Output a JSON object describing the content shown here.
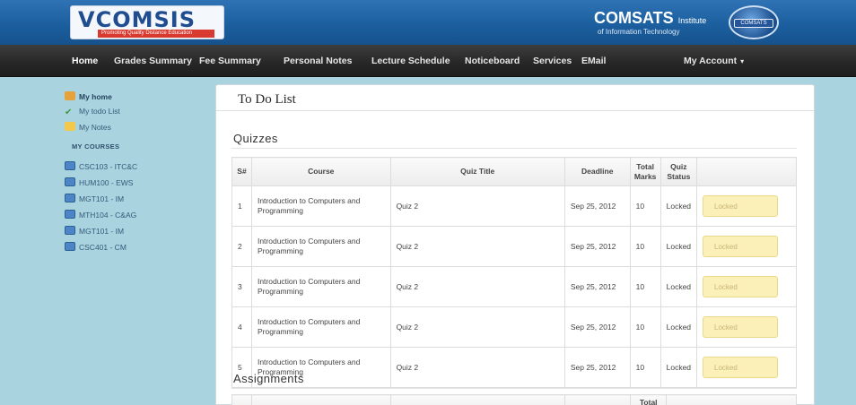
{
  "header": {
    "logo_left": {
      "wordmark": "VCOMSIS",
      "tagline": "Promoting Quality Distance Education"
    },
    "logo_right": {
      "name": "COMSATS",
      "name_suffix": "Institute",
      "subtitle": "of Information Technology",
      "seal_text": "COMSATS"
    }
  },
  "nav": {
    "items": [
      {
        "label": "Home"
      },
      {
        "label": "Grades Summary"
      },
      {
        "label": "Fee Summary"
      },
      {
        "label": "Personal Notes"
      },
      {
        "label": "Lecture Schedule"
      },
      {
        "label": "Noticeboard"
      },
      {
        "label": "Services"
      },
      {
        "label": "EMail"
      }
    ],
    "account_label": "My Account",
    "account_caret": "▾"
  },
  "sidebar": {
    "links": [
      {
        "label": "My home",
        "icon": "home-icon"
      },
      {
        "label": "My todo List",
        "icon": "check-icon"
      },
      {
        "label": "My Notes",
        "icon": "notes-icon"
      }
    ],
    "courses_heading": "MY COURSES",
    "courses": [
      {
        "label": "CSC103 - ITC&C"
      },
      {
        "label": "HUM100 - EWS"
      },
      {
        "label": "MGT101 - IM"
      },
      {
        "label": "MTH104 - C&AG"
      },
      {
        "label": "MGT101 - IM"
      },
      {
        "label": "CSC401 - CM"
      }
    ]
  },
  "main": {
    "title": "To Do List",
    "quizzes": {
      "heading": "Quizzes",
      "columns": {
        "sno": "S#",
        "course": "Course",
        "quiz_title": "Quiz Title",
        "deadline": "Deadline",
        "total_marks": "Total Marks",
        "quiz_status": "Quiz Status"
      },
      "rows": [
        {
          "sno": "1",
          "course": "Introduction to Computers and Programming",
          "quiz_title": "Quiz 2",
          "deadline": "Sep 25, 2012",
          "total_marks": "10",
          "status": "Locked",
          "action": "Locked"
        },
        {
          "sno": "2",
          "course": "Introduction to Computers and Programming",
          "quiz_title": "Quiz 2",
          "deadline": "Sep 25, 2012",
          "total_marks": "10",
          "status": "Locked",
          "action": "Locked"
        },
        {
          "sno": "3",
          "course": "Introduction to Computers and Programming",
          "quiz_title": "Quiz 2",
          "deadline": "Sep 25, 2012",
          "total_marks": "10",
          "status": "Locked",
          "action": "Locked"
        },
        {
          "sno": "4",
          "course": "Introduction to Computers and Programming",
          "quiz_title": "Quiz 2",
          "deadline": "Sep 25, 2012",
          "total_marks": "10",
          "status": "Locked",
          "action": "Locked"
        },
        {
          "sno": "5",
          "course": "Introduction to Computers and Programming",
          "quiz_title": "Quiz 2",
          "deadline": "Sep 25, 2012",
          "total_marks": "10",
          "status": "Locked",
          "action": "Locked"
        }
      ]
    },
    "assignments": {
      "heading": "Assignments",
      "columns": {
        "total": "Total"
      }
    }
  }
}
